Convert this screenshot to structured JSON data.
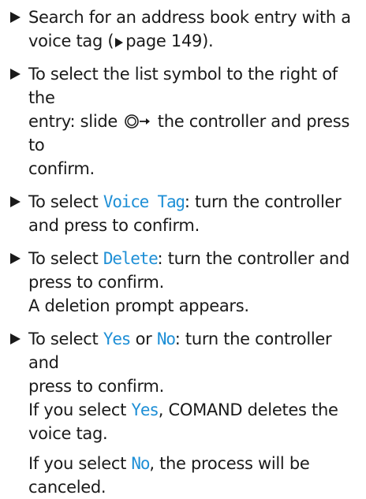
{
  "steps": [
    {
      "line1": "Search for an address book entry with a",
      "line2_pre": "voice tag (",
      "line2_page": "page 149",
      "line2_post": ")."
    },
    {
      "line1": "To select the list symbol to the right of the",
      "line2_pre": "entry: slide",
      "line2_post": "the controller and press to",
      "line3": "confirm."
    },
    {
      "pre": "To select",
      "hl": "Voice Tag",
      "post": ": turn the controller",
      "line2": "and press to confirm."
    },
    {
      "pre": "To select",
      "hl": "Delete",
      "post": ": turn the controller and",
      "line2": "press to confirm.",
      "line3": "A deletion prompt appears."
    },
    {
      "pre": "To select",
      "hl_yes": "Yes",
      "mid": "or",
      "hl_no": "No",
      "post": ": turn the controller and",
      "line2": "press to confirm.",
      "line3_pre": "If you select",
      "line3_hl": "Yes",
      "line3_post": ", COMAND deletes the",
      "line4": "voice tag.",
      "para2_pre": "If you select",
      "para2_hl": "No",
      "para2_post": ", the process will be",
      "para2_line2": "canceled."
    }
  ],
  "icons": {
    "bullet": "triangle-bullet-icon",
    "page_ref": "page-reference-arrow-icon",
    "controller": "controller-slide-right-icon"
  },
  "colors": {
    "text": "#1a1a1a",
    "highlight": "#1e8fd6"
  }
}
